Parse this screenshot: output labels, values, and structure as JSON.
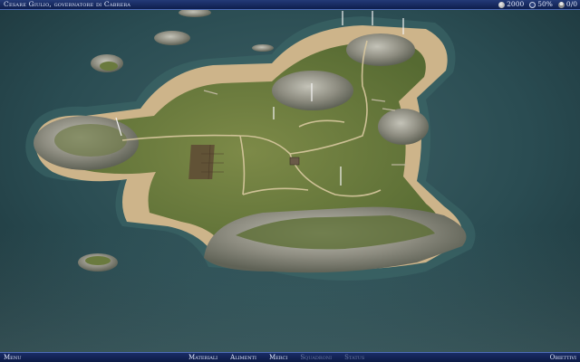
{
  "topbar": {
    "title": "Cesare Giulio, governatore di Cabrera",
    "stats": [
      {
        "icon": "coin-icon",
        "value": "2000"
      },
      {
        "icon": "approval-icon",
        "value": "50%"
      },
      {
        "icon": "population-icon",
        "value": "0/0"
      }
    ]
  },
  "bottombar": {
    "menu_label": "Menu",
    "objectives_label": "Obiettivi",
    "tabs": [
      {
        "label": "Materiali",
        "enabled": true
      },
      {
        "label": "Alimenti",
        "enabled": true
      },
      {
        "label": "Merci",
        "enabled": true
      },
      {
        "label": "Squadroni",
        "enabled": false
      },
      {
        "label": "Status",
        "enabled": false
      }
    ]
  },
  "colors": {
    "bar_top": "#233a78",
    "bar_border": "#4d6bb8",
    "sea": "#27494f",
    "sand": "#cdb48a",
    "grass": "#6a7a3e",
    "rock": "#9a9a90"
  }
}
